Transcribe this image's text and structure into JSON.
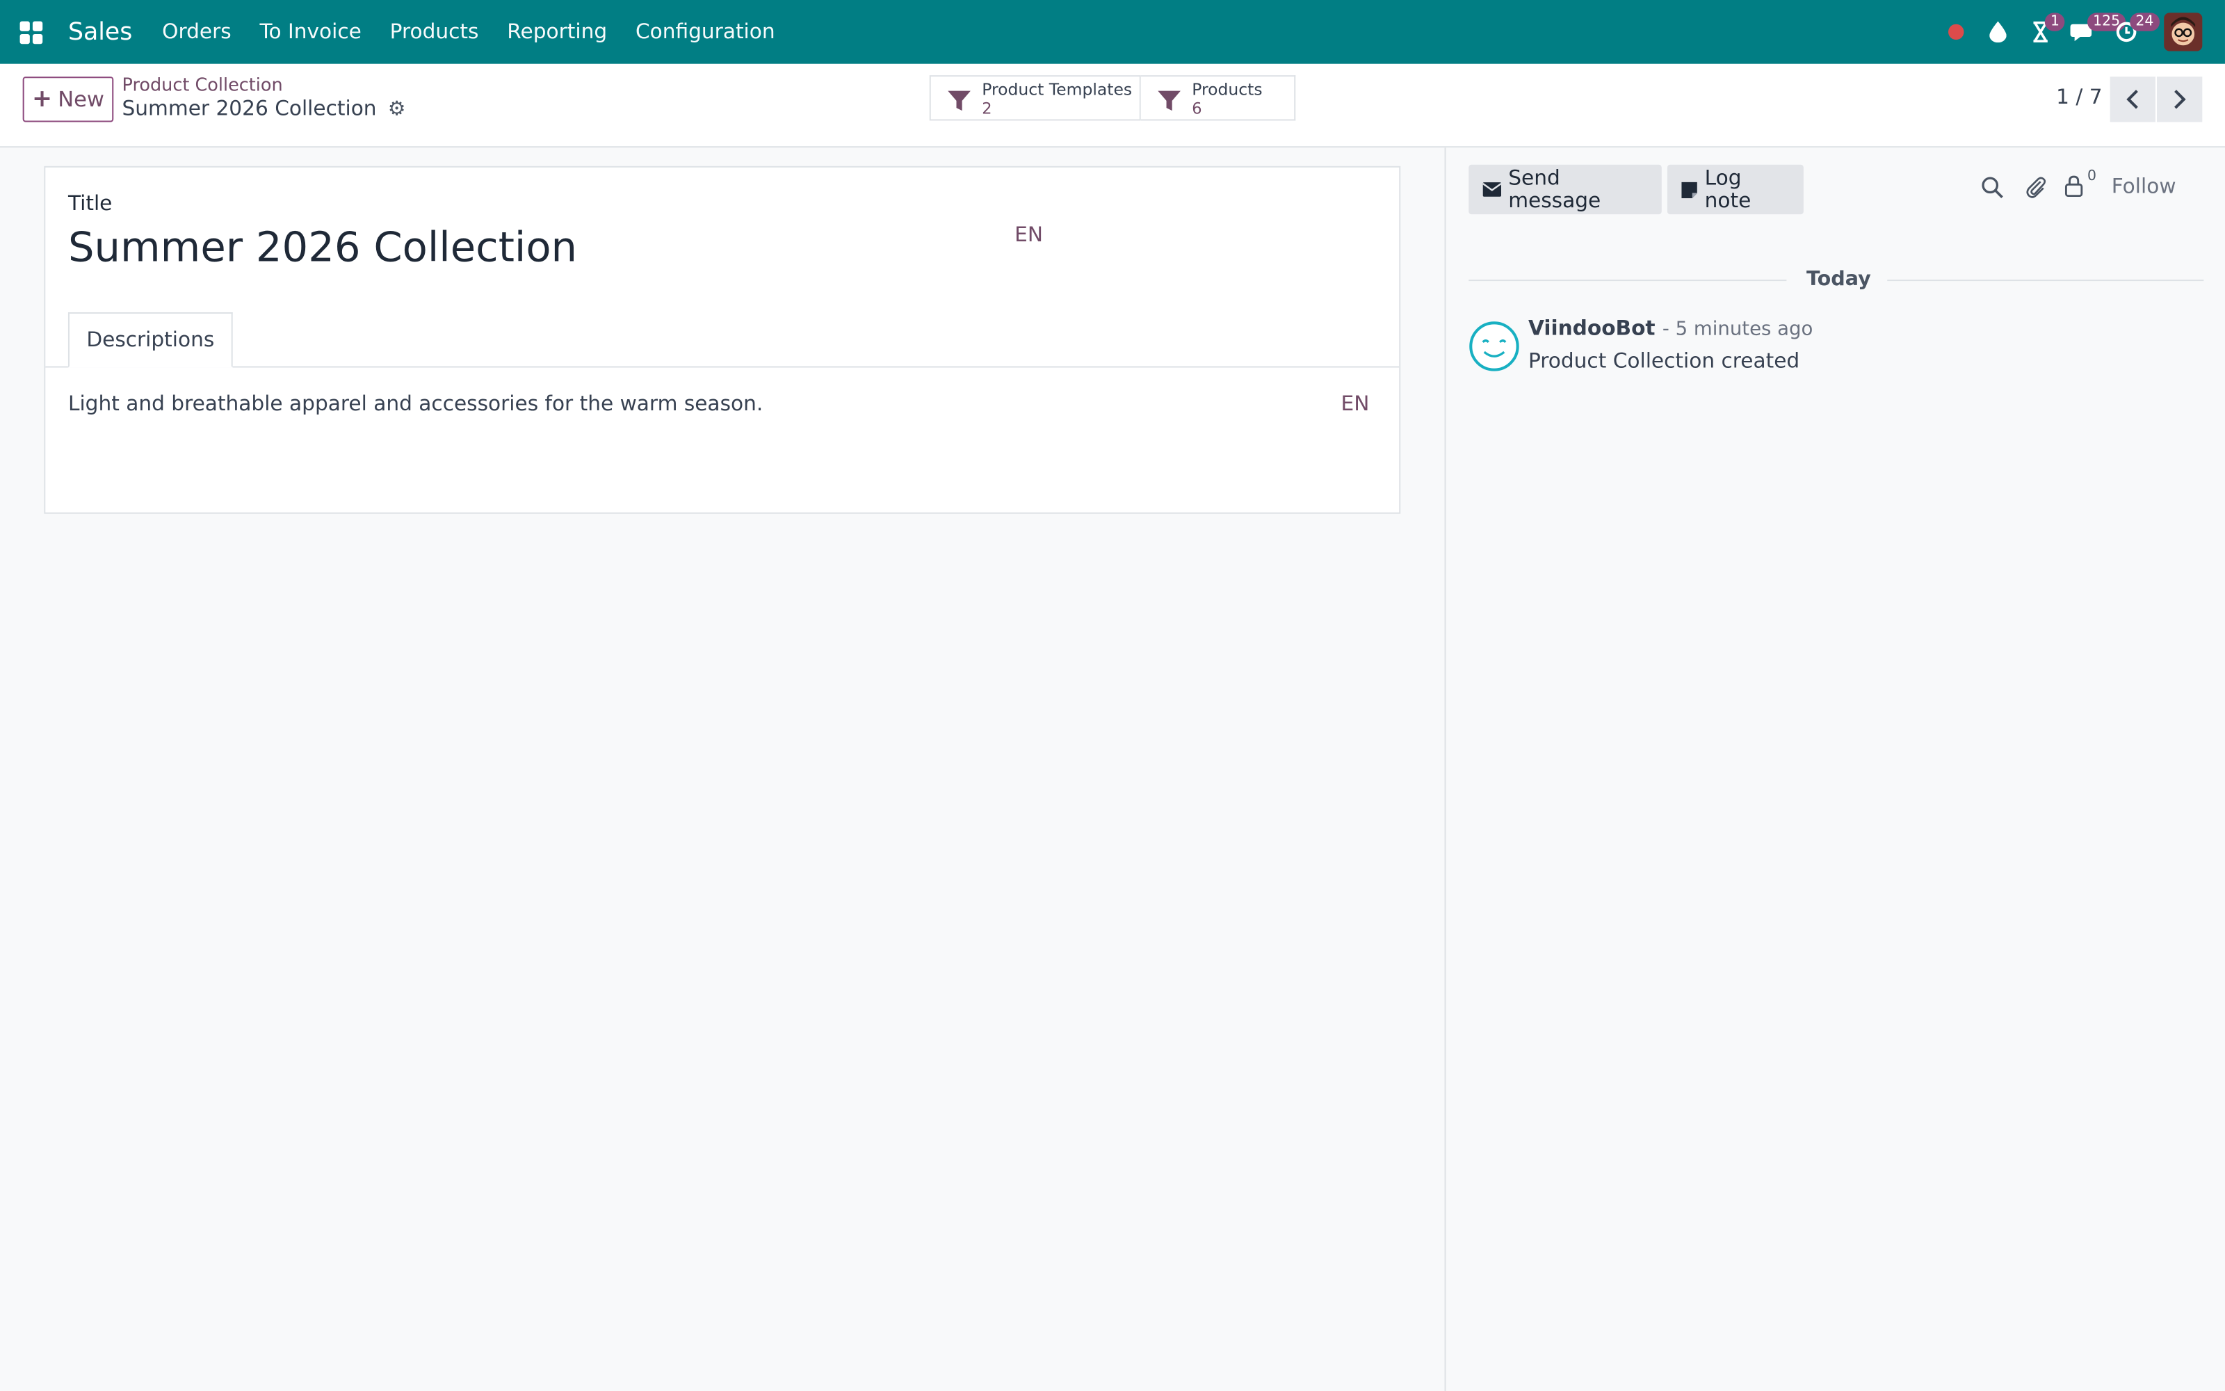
{
  "navbar": {
    "app_name": "Sales",
    "menu": [
      "Orders",
      "To Invoice",
      "Products",
      "Reporting",
      "Configuration"
    ],
    "badges": {
      "activities": "1",
      "messages": "125",
      "activity_timer": "24"
    },
    "accent_color": "#017e84"
  },
  "control_panel": {
    "new_label": "New",
    "breadcrumb_parent": "Product Collection",
    "breadcrumb_current": "Summer 2026 Collection",
    "smart_buttons": [
      {
        "label": "Product Templates",
        "count": "2"
      },
      {
        "label": "Products",
        "count": "6"
      }
    ],
    "pager": "1 / 7"
  },
  "form": {
    "title_label": "Title",
    "title_value": "Summer 2026 Collection",
    "title_lang": "EN",
    "tab_label": "Descriptions",
    "description": "Light and breathable apparel and accessories for the warm season.",
    "description_lang": "EN"
  },
  "chatter": {
    "send_message": "Send message",
    "log_note": "Log note",
    "followers_count": "0",
    "follow_label": "Follow",
    "date_separator": "Today",
    "messages": [
      {
        "author": "ViindooBot",
        "date": "- 5 minutes ago",
        "body": "Product Collection created"
      }
    ]
  }
}
